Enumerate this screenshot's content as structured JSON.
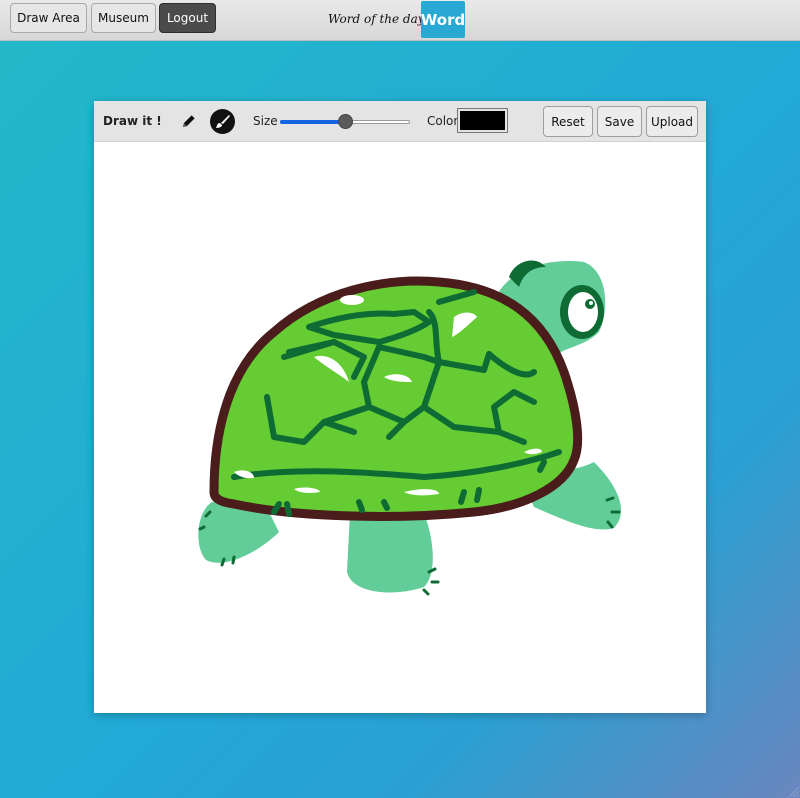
{
  "topbar": {
    "buttons": [
      {
        "label": "Draw Area"
      },
      {
        "label": "Museum"
      },
      {
        "label": "Logout"
      }
    ],
    "word_of_day_label": "Word of the day :",
    "word_of_day_value": "Word"
  },
  "toolbar": {
    "title": "Draw it !",
    "tools": [
      {
        "icon": "pencil-icon",
        "selected": false
      },
      {
        "icon": "brush-icon",
        "selected": true
      }
    ],
    "size_label": "Size",
    "size_value_fraction": 0.5,
    "color_label": "Color",
    "color_value": "#000000",
    "reset_label": "Reset",
    "save_label": "Save",
    "upload_label": "Upload"
  },
  "canvas": {
    "drawing": "turtle-illustration"
  },
  "colors": {
    "shell_green": "#66cc33",
    "shell_dark": "#0e6b34",
    "shell_outline": "#4a1c1c",
    "skin": "#63cd9a",
    "accent_blue": "#2aa8d4"
  }
}
